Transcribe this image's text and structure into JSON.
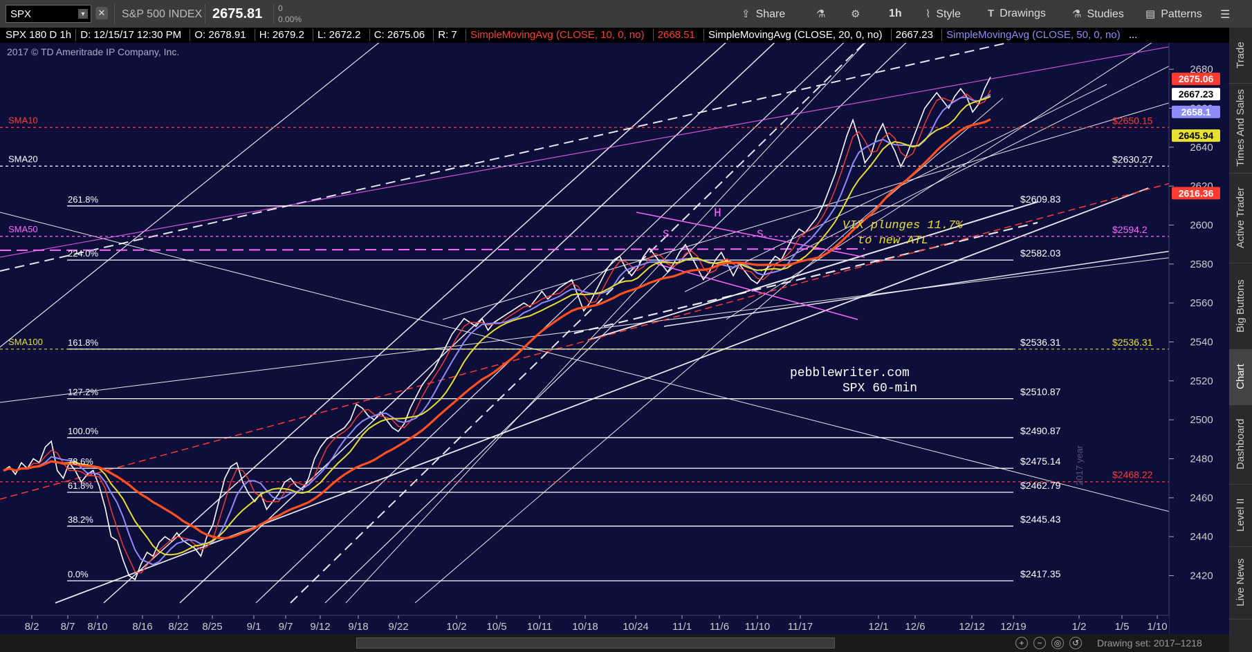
{
  "toolbar": {
    "symbol": "SPX",
    "index_name": "S&P 500 INDEX",
    "last_price": "2675.81",
    "change": "0",
    "change_pct": "0.00%",
    "share_label": "Share",
    "timeframe_label": "1h",
    "style_label": "Style",
    "drawings_label": "Drawings",
    "studies_label": "Studies",
    "patterns_label": "Patterns"
  },
  "infobar": {
    "desc": "SPX 180 D 1h",
    "date": "D: 12/15/17 12:30 PM",
    "open": "O: 2678.91",
    "high": "H: 2679.2",
    "low": "L: 2672.2",
    "close": "C: 2675.06",
    "range": "R: 7",
    "sma10": "SimpleMovingAvg (CLOSE, 10, 0, no)",
    "sma10_val": "2668.51",
    "sma20": "SimpleMovingAvg (CLOSE, 20, 0, no)",
    "sma20_val": "2667.23",
    "sma50": "SimpleMovingAvg (CLOSE, 50, 0, no)",
    "more": "..."
  },
  "right_tabs": [
    "Trade",
    "Times And Sales",
    "Active Trader",
    "Big Buttons",
    "Chart",
    "Dashboard",
    "Level II",
    "Live News"
  ],
  "footer": {
    "drawing_set": "Drawing set: 2017–1218"
  },
  "colors": {
    "background": "#0e0e3a",
    "sma10": "#ff3b30",
    "sma20": "#ffffff",
    "sma50": "#8c8cff",
    "sma100": "#e8e030",
    "sma200": "#ff5020",
    "magenta": "#ff66ff"
  },
  "chart_data": {
    "type": "line",
    "copyright": "2017 © TD Ameritrade IP Company, Inc.",
    "x_ticks": [
      "8/2",
      "8/7",
      "8/10",
      "8/16",
      "8/22",
      "8/25",
      "9/1",
      "9/7",
      "9/12",
      "9/18",
      "9/22",
      "10/2",
      "10/5",
      "10/11",
      "10/18",
      "10/24",
      "11/1",
      "11/6",
      "11/10",
      "11/17",
      "12/1",
      "12/6",
      "12/12",
      "12/19",
      "1/2",
      "1/5",
      "1/10"
    ],
    "y_ticks": [
      2420,
      2440,
      2460,
      2480,
      2500,
      2520,
      2540,
      2560,
      2580,
      2600,
      2620,
      2640,
      2660,
      2680
    ],
    "ylim": [
      2406,
      2690
    ],
    "fib_levels": [
      {
        "label": "261.8%",
        "value": 2609.83,
        "price": "$2609.83"
      },
      {
        "label": "224.0%",
        "value": 2582.03,
        "price": "$2582.03"
      },
      {
        "label": "161.8%",
        "value": 2536.31,
        "price": "$2536.31"
      },
      {
        "label": "127.2%",
        "value": 2510.87,
        "price": "$2510.87"
      },
      {
        "label": "100.0%",
        "value": 2490.87,
        "price": "$2490.87"
      },
      {
        "label": "78.6%",
        "value": 2475.14,
        "price": "$2475.14"
      },
      {
        "label": "61.8%",
        "value": 2462.79,
        "price": "$2462.79"
      },
      {
        "label": "38.2%",
        "value": 2445.43,
        "price": "$2445.43"
      },
      {
        "label": "0.0%",
        "value": 2417.35,
        "price": "$2417.35"
      }
    ],
    "sma_lines": [
      {
        "label": "SMA10",
        "value": 2650.15,
        "price": "$2650.15",
        "color": "#ff3b30"
      },
      {
        "label": "SMA20",
        "value": 2630.27,
        "price": "$2630.27",
        "color": "#ffffff"
      },
      {
        "label": "SMA50",
        "value": 2594.2,
        "price": "$2594.2",
        "color": "#ff66ff"
      },
      {
        "label": "SMA100",
        "value": 2536.31,
        "price": "$2536.31",
        "color": "#e8e030"
      },
      {
        "label": "",
        "value": 2468.22,
        "price": "$2468.22",
        "color": "#ff3b30"
      }
    ],
    "price_badges": [
      {
        "value": 2675.06,
        "label": "2675.06",
        "bg": "#ff3b30",
        "fg": "#ffffff"
      },
      {
        "value": 2667.23,
        "label": "2667.23",
        "bg": "#ffffff",
        "fg": "#000000"
      },
      {
        "value": 2658.1,
        "label": "2658.1",
        "bg": "#8c8cff",
        "fg": "#ffffff"
      },
      {
        "value": 2645.94,
        "label": "2645.94",
        "bg": "#e8e030",
        "fg": "#000000"
      },
      {
        "value": 2616.36,
        "label": "2616.36",
        "bg": "#ff3b30",
        "fg": "#ffffff"
      }
    ],
    "annotations": {
      "vix_line1": "VIX plunges 11.7%",
      "vix_line2": "to new ATL",
      "site": "pebblewriter.com",
      "chart_name": "SPX 60-min",
      "year": "2017 year",
      "pattern_h": "H",
      "pattern_s1": "S",
      "pattern_s2": "S"
    },
    "series": [
      {
        "name": "SPX",
        "color": "#ffffff",
        "x": [
          0,
          1,
          2,
          3,
          4,
          5,
          6,
          7,
          8,
          9,
          10,
          11,
          12,
          13,
          14,
          15,
          16,
          17,
          18,
          19,
          20,
          21,
          22,
          23,
          24,
          25,
          26,
          27,
          28,
          29,
          30,
          31,
          32,
          33,
          34,
          35,
          36,
          37,
          38,
          39,
          40,
          41,
          42,
          43,
          44,
          45,
          46,
          47,
          48,
          49,
          50,
          51,
          52,
          53,
          54,
          55,
          56,
          57,
          58,
          59,
          60,
          61,
          62,
          63,
          64,
          65,
          66,
          67,
          68,
          69,
          70,
          71,
          72,
          73,
          74,
          75,
          76,
          77,
          78,
          79,
          80,
          81,
          82,
          83,
          84,
          85,
          86,
          87,
          88,
          89,
          90,
          91,
          92,
          93,
          94,
          95,
          96,
          97,
          98,
          99,
          100,
          101,
          102,
          103,
          104,
          105,
          106,
          107,
          108,
          109,
          110,
          111,
          112,
          113,
          114,
          115,
          116,
          117,
          118,
          119,
          120,
          121,
          122,
          123,
          124,
          125,
          126,
          127,
          128,
          129,
          130,
          131,
          132,
          133,
          134,
          135,
          136,
          137,
          138,
          139,
          140,
          141,
          142,
          143,
          144,
          145,
          146,
          147,
          148,
          149,
          150,
          151,
          152,
          153,
          154,
          155,
          156,
          157,
          158,
          159,
          160,
          161,
          162,
          163,
          164,
          165
        ],
        "y": [
          2474,
          2476,
          2472,
          2478,
          2475,
          2480,
          2478,
          2486,
          2489,
          2474,
          2470,
          2478,
          2474,
          2468,
          2472,
          2474,
          2466,
          2455,
          2440,
          2438,
          2428,
          2420,
          2418,
          2426,
          2432,
          2430,
          2437,
          2440,
          2438,
          2442,
          2438,
          2436,
          2434,
          2430,
          2440,
          2446,
          2458,
          2470,
          2476,
          2478,
          2468,
          2462,
          2458,
          2462,
          2454,
          2458,
          2462,
          2468,
          2470,
          2466,
          2464,
          2470,
          2480,
          2486,
          2490,
          2492,
          2494,
          2496,
          2500,
          2508,
          2506,
          2502,
          2500,
          2504,
          2500,
          2496,
          2494,
          2498,
          2506,
          2512,
          2518,
          2522,
          2526,
          2532,
          2538,
          2544,
          2548,
          2552,
          2550,
          2548,
          2552,
          2546,
          2550,
          2552,
          2554,
          2556,
          2558,
          2560,
          2558,
          2562,
          2566,
          2562,
          2565,
          2568,
          2570,
          2572,
          2564,
          2556,
          2560,
          2566,
          2572,
          2578,
          2582,
          2584,
          2578,
          2574,
          2578,
          2584,
          2588,
          2584,
          2580,
          2576,
          2580,
          2586,
          2590,
          2584,
          2578,
          2572,
          2576,
          2582,
          2586,
          2580,
          2574,
          2580,
          2576,
          2572,
          2570,
          2574,
          2580,
          2584,
          2582,
          2588,
          2594,
          2598,
          2596,
          2600,
          2604,
          2610,
          2618,
          2626,
          2636,
          2646,
          2654,
          2644,
          2632,
          2636,
          2646,
          2652,
          2644,
          2638,
          2630,
          2636,
          2644,
          2652,
          2660,
          2664,
          2668,
          2664,
          2660,
          2666,
          2670,
          2666,
          2658,
          2662,
          2670,
          2676
        ]
      }
    ]
  }
}
